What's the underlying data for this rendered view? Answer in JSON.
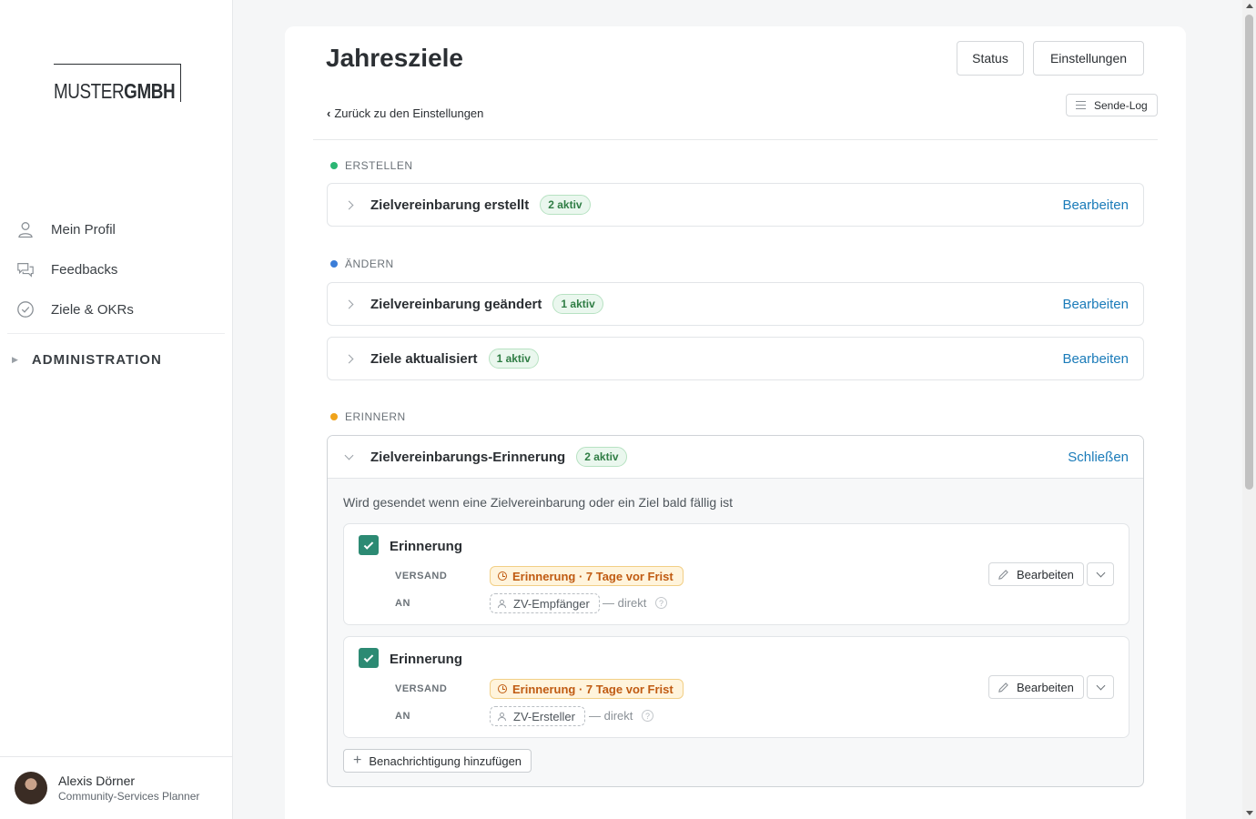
{
  "sidebar": {
    "logo": {
      "light": "MUSTER",
      "bold": "GMBH"
    },
    "nav": [
      {
        "label": "Mein Profil",
        "icon": "person-icon"
      },
      {
        "label": "Feedbacks",
        "icon": "chat-icon"
      },
      {
        "label": "Ziele & OKRs",
        "icon": "check-circle-icon"
      }
    ],
    "admin_label": "ADMINISTRATION",
    "user": {
      "name": "Alexis Dörner",
      "role": "Community-Services Planner"
    }
  },
  "header": {
    "title": "Jahresziele",
    "status_button": "Status",
    "settings_button": "Einstellungen",
    "back_link": "Zurück zu den Einstellungen",
    "log_button": "Sende-Log"
  },
  "sections": {
    "create": {
      "label": "ERSTELLEN",
      "color": "#2bb673"
    },
    "change": {
      "label": "ÄNDERN",
      "color": "#3b7dd8"
    },
    "remind": {
      "label": "ERINNERN",
      "color": "#f0a31a"
    }
  },
  "rows": [
    {
      "title": "Zielvereinbarung erstellt",
      "badge": "2 aktiv",
      "action": "Bearbeiten"
    },
    {
      "title": "Zielvereinbarung geändert",
      "badge": "1 aktiv",
      "action": "Bearbeiten"
    },
    {
      "title": "Ziele aktualisiert",
      "badge": "1 aktiv",
      "action": "Bearbeiten"
    }
  ],
  "panel": {
    "title": "Zielvereinbarungs-Erinnerung",
    "badge": "2 aktiv",
    "close": "Schließen",
    "description": "Wird gesendet wenn eine Zielvereinbarung oder ein Ziel bald fällig ist",
    "notifications": [
      {
        "title": "Erinnerung",
        "send_label": "VERSAND",
        "send_value": "Erinnerung · 7 Tage vor Frist",
        "to_label": "AN",
        "recipient": "ZV-Empfänger",
        "direct": "— direkt",
        "help": "?",
        "edit": "Bearbeiten",
        "checked": true
      },
      {
        "title": "Erinnerung",
        "send_label": "VERSAND",
        "send_value": "Erinnerung · 7 Tage vor Frist",
        "to_label": "AN",
        "recipient": "ZV-Ersteller",
        "direct": "— direkt",
        "help": "?",
        "edit": "Bearbeiten",
        "checked": true
      }
    ],
    "add_button": "Benachrichtigung hinzufügen"
  }
}
